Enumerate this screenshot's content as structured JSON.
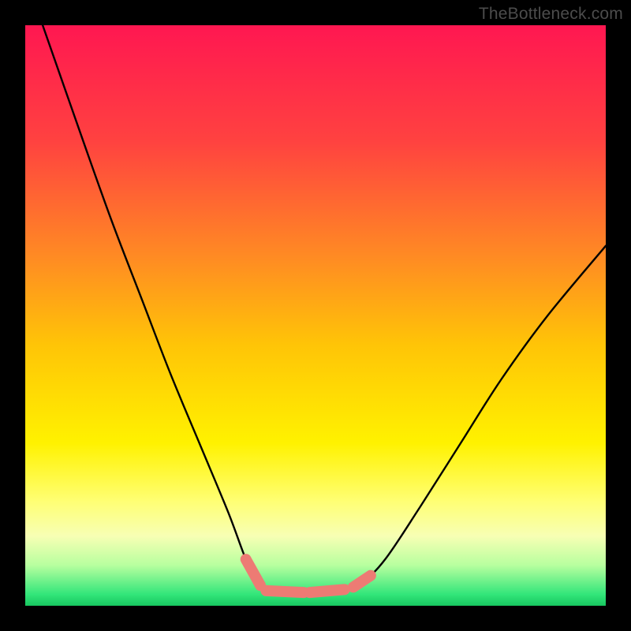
{
  "watermark": "TheBottleneck.com",
  "chart_data": {
    "type": "line",
    "title": "",
    "xlabel": "",
    "ylabel": "",
    "xlim": [
      0,
      100
    ],
    "ylim": [
      0,
      100
    ],
    "series": [
      {
        "name": "curve",
        "x": [
          3,
          10,
          15,
          20,
          25,
          30,
          35,
          38,
          40,
          42,
          45,
          48,
          52,
          55,
          58,
          62,
          68,
          75,
          82,
          90,
          100
        ],
        "values": [
          100,
          80,
          66,
          53,
          40,
          28,
          16,
          8,
          4,
          2.8,
          2.3,
          2.3,
          2.3,
          2.8,
          4,
          8,
          17,
          28,
          39,
          50,
          62
        ]
      }
    ],
    "trough_markers": {
      "color": "#ed7b74",
      "segments": [
        {
          "x1": 38.0,
          "y1": 8.0,
          "x2": 40.5,
          "y2": 3.5
        },
        {
          "x1": 41.5,
          "y1": 2.6,
          "x2": 48.0,
          "y2": 2.3
        },
        {
          "x1": 49.0,
          "y1": 2.3,
          "x2": 55.0,
          "y2": 2.8
        },
        {
          "x1": 56.5,
          "y1": 3.2,
          "x2": 59.5,
          "y2": 5.2
        }
      ]
    },
    "background_gradient": {
      "stops": [
        {
          "pos": 0.0,
          "color": "#ff1751"
        },
        {
          "pos": 0.2,
          "color": "#ff4240"
        },
        {
          "pos": 0.4,
          "color": "#ff8b23"
        },
        {
          "pos": 0.55,
          "color": "#ffc407"
        },
        {
          "pos": 0.72,
          "color": "#fff200"
        },
        {
          "pos": 0.82,
          "color": "#ffff74"
        },
        {
          "pos": 0.88,
          "color": "#f7ffb4"
        },
        {
          "pos": 0.93,
          "color": "#b8ff9f"
        },
        {
          "pos": 0.98,
          "color": "#33e67a"
        },
        {
          "pos": 1.0,
          "color": "#17c760"
        }
      ]
    }
  }
}
